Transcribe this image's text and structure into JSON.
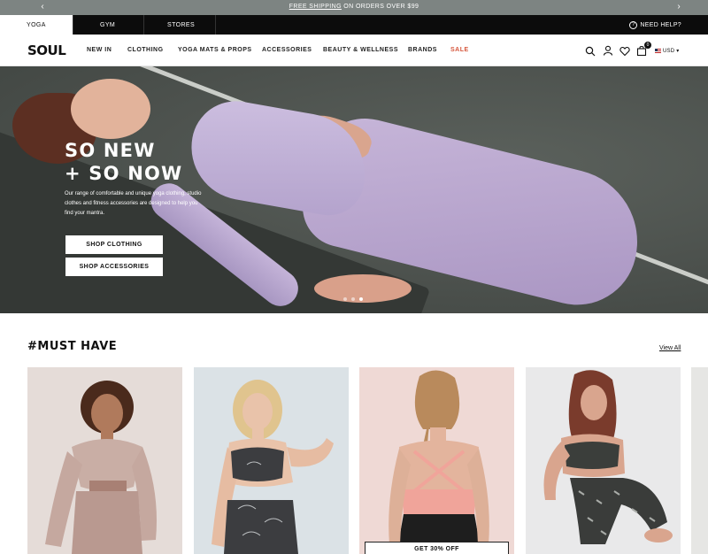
{
  "announcement": {
    "prev_arrow": "‹",
    "next_arrow": "›",
    "link_text": "FREE SHIPPING",
    "message": " ON ORDERS OVER $99"
  },
  "topbar": {
    "tabs": [
      {
        "label": "YOGA",
        "active": true
      },
      {
        "label": "GYM",
        "active": false
      },
      {
        "label": "STORES",
        "active": false
      }
    ],
    "help_label": "NEED HELP?"
  },
  "nav": {
    "logo": "SOUL",
    "items": [
      "NEW IN",
      "CLOTHING",
      "YOGA MATS & PROPS",
      "ACCESSORIES",
      "BEAUTY & WELLNESS",
      "BRANDS",
      "SALE"
    ],
    "cart_count": "0",
    "currency": "USD"
  },
  "hero": {
    "title_line1": "SO NEW",
    "title_line2": "+ SO NOW",
    "description": "Our range of comfortable and unique yoga clothing, studio clothes and fitness accessories are designed to help you find your mantra.",
    "buttons": [
      "SHOP CLOTHING",
      "SHOP ACCESSORIES"
    ],
    "slides": 3,
    "active_slide": 2
  },
  "must_have": {
    "title": "#MUST HAVE",
    "view_all": "View All",
    "cards": [
      {
        "cta": ""
      },
      {
        "cta": ""
      },
      {
        "cta": "GET 30% OFF"
      },
      {
        "cta": ""
      }
    ]
  },
  "colors": {
    "announce_bg": "#7d8482",
    "topbar_bg": "#0c0c0c",
    "sale": "#d6563c",
    "lilac": "#b9a8d2"
  }
}
